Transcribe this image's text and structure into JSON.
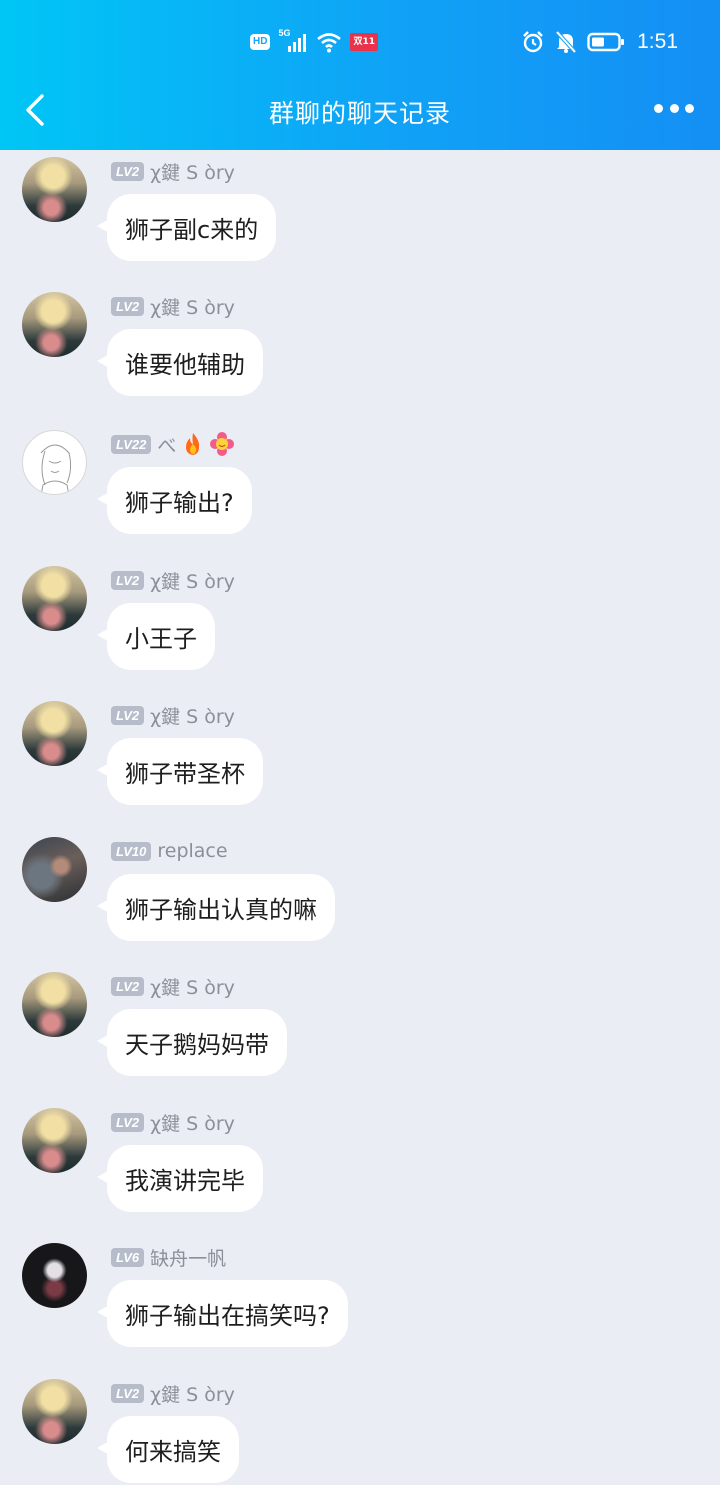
{
  "status_bar": {
    "hd": "HD",
    "network": "5G",
    "badge": "双11",
    "time": "1:51"
  },
  "header": {
    "title": "群聊的聊天记录"
  },
  "messages": [
    {
      "level": "LV2",
      "name": "χ鍵 S òry",
      "text": "狮子副c来的",
      "avatar": "blonde-avatar"
    },
    {
      "level": "LV2",
      "name": "χ鍵 S òry",
      "text": "谁要他辅助",
      "avatar": "blonde-avatar"
    },
    {
      "level": "LV22",
      "name": "べ",
      "text": "狮子输出?",
      "avatar": "sketch-avatar"
    },
    {
      "level": "LV2",
      "name": "χ鍵 S òry",
      "text": "小王子",
      "avatar": "blonde-avatar"
    },
    {
      "level": "LV2",
      "name": "χ鍵 S òry",
      "text": "狮子带圣杯",
      "avatar": "blonde-avatar"
    },
    {
      "level": "LV10",
      "name": "replace",
      "text": "狮子输出认真的嘛",
      "avatar": "dark-avatar"
    },
    {
      "level": "LV2",
      "name": "χ鍵 S òry",
      "text": "天子鹅妈妈带",
      "avatar": "blonde-avatar"
    },
    {
      "level": "LV2",
      "name": "χ鍵 S òry",
      "text": "我演讲完毕",
      "avatar": "blonde-avatar"
    },
    {
      "level": "LV6",
      "name": "缺舟一帆",
      "text": "狮子输出在搞笑吗?",
      "avatar": "black-avatar"
    },
    {
      "level": "LV2",
      "name": "χ鍵 S òry",
      "text": "何来搞笑",
      "avatar": "blonde-avatar"
    }
  ],
  "colors": {
    "header_gradient_start": "#00c6f5",
    "header_gradient_end": "#148ff5",
    "background": "#eaedf4",
    "bubble": "#ffffff",
    "level_badge": "#b7bccb"
  }
}
